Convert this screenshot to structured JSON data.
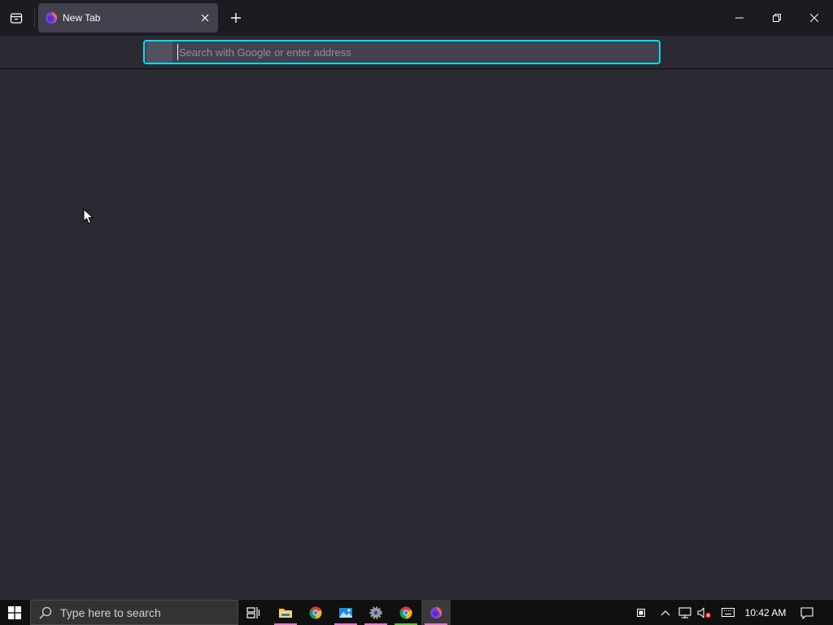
{
  "browser": {
    "tab": {
      "title": "New Tab"
    },
    "urlbar": {
      "placeholder": "Search with Google or enter address",
      "value": ""
    }
  },
  "taskbar": {
    "search_placeholder": "Type here to search",
    "clock": "10:42 AM",
    "apps": [
      {
        "name": "file-explorer",
        "indicator": "#e878c8"
      },
      {
        "name": "chrome",
        "indicator": ""
      },
      {
        "name": "photos",
        "indicator": "#e878c8"
      },
      {
        "name": "settings",
        "indicator": "#e878c8"
      },
      {
        "name": "chrome-active",
        "indicator": "#66c23a"
      },
      {
        "name": "firefox",
        "indicator": "#e878c8"
      }
    ]
  },
  "colors": {
    "accent": "#00ddff",
    "tab_bg": "#42414d",
    "page_bg": "#2b2a33",
    "titlebar_bg": "#1c1b22"
  }
}
